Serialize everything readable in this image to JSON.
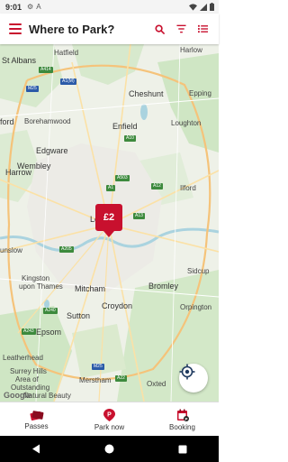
{
  "status_bar": {
    "time": "9:01"
  },
  "app_bar": {
    "title": "Where to Park?"
  },
  "map": {
    "places": {
      "st_albans": "St Albans",
      "hatfield": "Hatfield",
      "harlow": "Harlow",
      "cheshunt": "Cheshunt",
      "epping": "Epping",
      "ford": "ford",
      "borehamwood": "Borehamwood",
      "enfield": "Enfield",
      "loughton": "Loughton",
      "edgware": "Edgware",
      "harrow": "Harrow",
      "ilford": "Ilford",
      "wembley": "Wembley",
      "london": "Lo",
      "unslow": "unslow",
      "sidcup": "Sidcup",
      "kingston": "Kingston",
      "upon_thames": "upon Thames",
      "mitcham": "Mitcham",
      "bromley": "Bromley",
      "croydon": "Croydon",
      "orpington": "Orpington",
      "sutton": "Sutton",
      "epsom": "Epsom",
      "leatherhead": "Leatherhead",
      "surrey_hills": "Surrey Hills",
      "area_of": "Area of",
      "outstanding": "Outstanding",
      "natural_beauty": "Natural Beauty",
      "merstham": "Merstham",
      "oxted": "Oxted",
      "google": "Google"
    },
    "roads": {
      "a414": "A414",
      "a1m": "A1(M)",
      "m25": "M25",
      "a10": "A10",
      "a503": "A503",
      "a12": "A12",
      "a1": "A1",
      "a13": "A13",
      "a205": "A205",
      "a240": "A240",
      "a243": "A243",
      "m25b": "M25",
      "a22": "A22"
    },
    "pin": {
      "price": "£2"
    }
  },
  "bottom_nav": {
    "passes": "Passes",
    "park_now": "Park now",
    "booking": "Booking"
  },
  "colors": {
    "brand": "#c8102e",
    "map_bg": "#eef1e8",
    "park": "#cfe6c4",
    "water": "#aad3df",
    "motorway": "#f5c37a"
  }
}
